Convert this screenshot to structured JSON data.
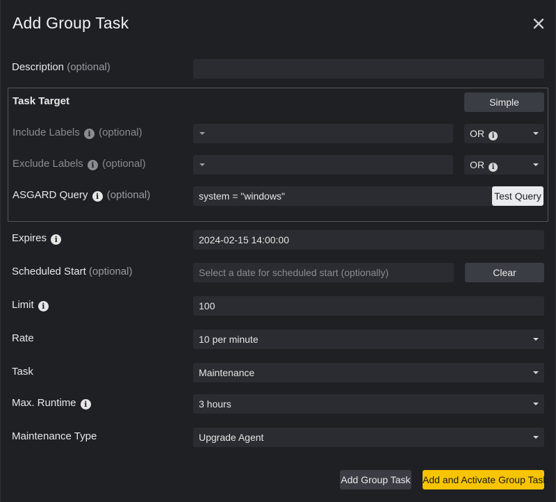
{
  "dialog": {
    "title": "Add Group Task"
  },
  "description": {
    "label": "Description",
    "optional": "(optional)",
    "value": ""
  },
  "task_target": {
    "heading": "Task Target",
    "mode_button": "Simple",
    "include_labels": {
      "label": "Include Labels",
      "optional": "(optional)",
      "value": "",
      "operator": "OR"
    },
    "exclude_labels": {
      "label": "Exclude Labels",
      "optional": "(optional)",
      "value": "",
      "operator": "OR"
    },
    "asgard_query": {
      "label": "ASGARD Query",
      "optional": "(optional)",
      "value": "system = \"windows\"",
      "test_button": "Test Query"
    }
  },
  "expires": {
    "label": "Expires",
    "value": "2024-02-15 14:00:00"
  },
  "scheduled_start": {
    "label": "Scheduled Start",
    "optional": "(optional)",
    "placeholder": "Select a date for scheduled start (optionally)",
    "clear_button": "Clear"
  },
  "limit": {
    "label": "Limit",
    "value": "100"
  },
  "rate": {
    "label": "Rate",
    "value": "10 per minute"
  },
  "task": {
    "label": "Task",
    "value": "Maintenance"
  },
  "max_runtime": {
    "label": "Max. Runtime",
    "value": "3 hours"
  },
  "maintenance_type": {
    "label": "Maintenance Type",
    "value": "Upgrade Agent"
  },
  "footer": {
    "add_button": "Add Group Task",
    "add_activate_button": "Add and Activate Group Task"
  },
  "icons": {
    "info": "info-icon",
    "close": "close-icon",
    "dropdown": "chevron-down-icon"
  },
  "colors": {
    "background": "#1f2024",
    "field": "#2b2c31",
    "primary": "#f7c400",
    "button": "#3b3d44"
  }
}
